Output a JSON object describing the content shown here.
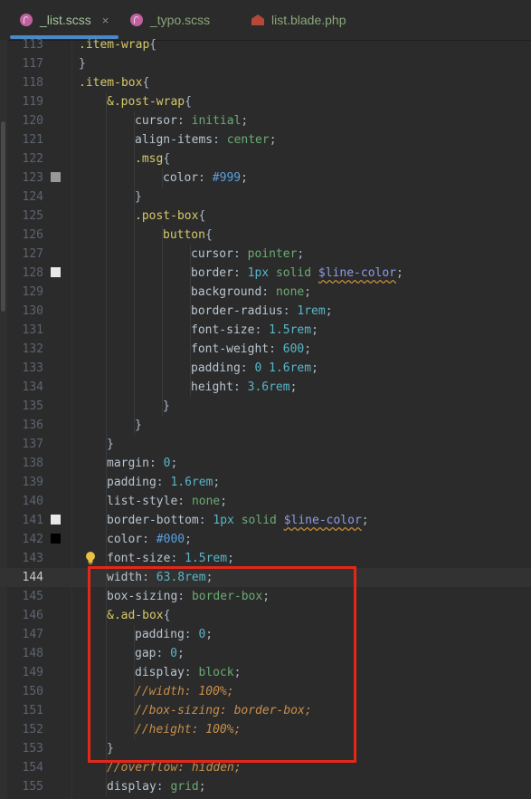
{
  "tabs": [
    {
      "label": "_list.scss",
      "icon": "sass-file-icon",
      "active": true,
      "close": "×"
    },
    {
      "label": "_typo.scss",
      "icon": "sass-file-icon",
      "active": false
    },
    {
      "label": "list.blade.php",
      "icon": "php-file-icon",
      "active": false
    }
  ],
  "colors": {
    "accent": "#4a88c7",
    "highlight_box": "#e3281a",
    "swatch_999": "#999999",
    "swatch_line_color": "#e8e8e8",
    "swatch_000": "#000000"
  },
  "editor": {
    "current_line": "144",
    "lines": [
      {
        "n": "113",
        "ind": 0,
        "tokens": [
          [
            ".item-wrap",
            "sel"
          ],
          [
            "{",
            "punc"
          ]
        ]
      },
      {
        "n": "117",
        "ind": 0,
        "tokens": [
          [
            "}",
            "punc"
          ]
        ]
      },
      {
        "n": "118",
        "ind": 0,
        "tokens": [
          [
            ".item-box",
            "sel"
          ],
          [
            "{",
            "punc"
          ]
        ]
      },
      {
        "n": "119",
        "ind": 1,
        "tokens": [
          [
            "&.post-wrap",
            "sel"
          ],
          [
            "{",
            "punc"
          ]
        ]
      },
      {
        "n": "120",
        "ind": 2,
        "tokens": [
          [
            "cursor",
            "prop"
          ],
          [
            ": ",
            "punc"
          ],
          [
            "initial",
            "kw"
          ],
          [
            ";",
            "punc"
          ]
        ]
      },
      {
        "n": "121",
        "ind": 2,
        "tokens": [
          [
            "align-items",
            "prop"
          ],
          [
            ": ",
            "punc"
          ],
          [
            "center",
            "kw"
          ],
          [
            ";",
            "punc"
          ]
        ]
      },
      {
        "n": "122",
        "ind": 2,
        "tokens": [
          [
            ".msg",
            "sel"
          ],
          [
            "{",
            "punc"
          ]
        ]
      },
      {
        "n": "123",
        "ind": 3,
        "swatch": "#999999",
        "tokens": [
          [
            "color",
            "prop"
          ],
          [
            ": ",
            "punc"
          ],
          [
            "#999",
            "hex"
          ],
          [
            ";",
            "punc"
          ]
        ]
      },
      {
        "n": "124",
        "ind": 2,
        "tokens": [
          [
            "}",
            "punc"
          ]
        ]
      },
      {
        "n": "125",
        "ind": 2,
        "tokens": [
          [
            ".post-box",
            "sel"
          ],
          [
            "{",
            "punc"
          ]
        ]
      },
      {
        "n": "126",
        "ind": 3,
        "tokens": [
          [
            "button",
            "sel"
          ],
          [
            "{",
            "punc"
          ]
        ]
      },
      {
        "n": "127",
        "ind": 4,
        "tokens": [
          [
            "cursor",
            "prop"
          ],
          [
            ": ",
            "punc"
          ],
          [
            "pointer",
            "kw"
          ],
          [
            ";",
            "punc"
          ]
        ]
      },
      {
        "n": "128",
        "ind": 4,
        "swatch": "#e8e8e8",
        "tokens": [
          [
            "border",
            "prop"
          ],
          [
            ": ",
            "punc"
          ],
          [
            "1px",
            "num"
          ],
          [
            " ",
            "punc"
          ],
          [
            "solid",
            "kw"
          ],
          [
            " ",
            "punc"
          ],
          [
            "$line-color",
            "var"
          ],
          [
            ";",
            "punc"
          ]
        ]
      },
      {
        "n": "129",
        "ind": 4,
        "tokens": [
          [
            "background",
            "prop"
          ],
          [
            ": ",
            "punc"
          ],
          [
            "none",
            "kw"
          ],
          [
            ";",
            "punc"
          ]
        ]
      },
      {
        "n": "130",
        "ind": 4,
        "tokens": [
          [
            "border-radius",
            "prop"
          ],
          [
            ": ",
            "punc"
          ],
          [
            "1rem",
            "num"
          ],
          [
            ";",
            "punc"
          ]
        ]
      },
      {
        "n": "131",
        "ind": 4,
        "tokens": [
          [
            "font-size",
            "prop"
          ],
          [
            ": ",
            "punc"
          ],
          [
            "1.5rem",
            "num"
          ],
          [
            ";",
            "punc"
          ]
        ]
      },
      {
        "n": "132",
        "ind": 4,
        "tokens": [
          [
            "font-weight",
            "prop"
          ],
          [
            ": ",
            "punc"
          ],
          [
            "600",
            "num"
          ],
          [
            ";",
            "punc"
          ]
        ]
      },
      {
        "n": "133",
        "ind": 4,
        "tokens": [
          [
            "padding",
            "prop"
          ],
          [
            ": ",
            "punc"
          ],
          [
            "0",
            "num"
          ],
          [
            " ",
            "punc"
          ],
          [
            "1.6rem",
            "num"
          ],
          [
            ";",
            "punc"
          ]
        ]
      },
      {
        "n": "134",
        "ind": 4,
        "tokens": [
          [
            "height",
            "prop"
          ],
          [
            ": ",
            "punc"
          ],
          [
            "3.6rem",
            "num"
          ],
          [
            ";",
            "punc"
          ]
        ]
      },
      {
        "n": "135",
        "ind": 3,
        "tokens": [
          [
            "}",
            "punc"
          ]
        ]
      },
      {
        "n": "136",
        "ind": 2,
        "tokens": [
          [
            "}",
            "punc"
          ]
        ]
      },
      {
        "n": "137",
        "ind": 1,
        "tokens": [
          [
            "}",
            "punc"
          ]
        ]
      },
      {
        "n": "138",
        "ind": 1,
        "tokens": [
          [
            "margin",
            "prop"
          ],
          [
            ": ",
            "punc"
          ],
          [
            "0",
            "num"
          ],
          [
            ";",
            "punc"
          ]
        ]
      },
      {
        "n": "139",
        "ind": 1,
        "tokens": [
          [
            "padding",
            "prop"
          ],
          [
            ": ",
            "punc"
          ],
          [
            "1.6rem",
            "num"
          ],
          [
            ";",
            "punc"
          ]
        ]
      },
      {
        "n": "140",
        "ind": 1,
        "tokens": [
          [
            "list-style",
            "prop"
          ],
          [
            ": ",
            "punc"
          ],
          [
            "none",
            "kw"
          ],
          [
            ";",
            "punc"
          ]
        ]
      },
      {
        "n": "141",
        "ind": 1,
        "swatch": "#e8e8e8",
        "tokens": [
          [
            "border-bottom",
            "prop"
          ],
          [
            ": ",
            "punc"
          ],
          [
            "1px",
            "num"
          ],
          [
            " ",
            "punc"
          ],
          [
            "solid",
            "kw"
          ],
          [
            " ",
            "punc"
          ],
          [
            "$line-color",
            "var"
          ],
          [
            ";",
            "punc"
          ]
        ]
      },
      {
        "n": "142",
        "ind": 1,
        "swatch": "#000000",
        "tokens": [
          [
            "color",
            "prop"
          ],
          [
            ": ",
            "punc"
          ],
          [
            "#000",
            "hex"
          ],
          [
            ";",
            "punc"
          ]
        ]
      },
      {
        "n": "143",
        "ind": 1,
        "bulb": true,
        "tokens": [
          [
            "font-size",
            "prop"
          ],
          [
            ": ",
            "punc"
          ],
          [
            "1.5rem",
            "num"
          ],
          [
            ";",
            "punc"
          ]
        ]
      },
      {
        "n": "144",
        "ind": 1,
        "tokens": [
          [
            "width",
            "prop"
          ],
          [
            ": ",
            "punc"
          ],
          [
            "63.8rem",
            "num"
          ],
          [
            ";",
            "punc"
          ]
        ]
      },
      {
        "n": "145",
        "ind": 1,
        "tokens": [
          [
            "box-sizing",
            "prop"
          ],
          [
            ": ",
            "punc"
          ],
          [
            "border-box",
            "kw"
          ],
          [
            ";",
            "punc"
          ]
        ]
      },
      {
        "n": "146",
        "ind": 1,
        "tokens": [
          [
            "&.ad-box",
            "sel"
          ],
          [
            "{",
            "punc"
          ]
        ]
      },
      {
        "n": "147",
        "ind": 2,
        "tokens": [
          [
            "padding",
            "prop"
          ],
          [
            ": ",
            "punc"
          ],
          [
            "0",
            "num"
          ],
          [
            ";",
            "punc"
          ]
        ]
      },
      {
        "n": "148",
        "ind": 2,
        "tokens": [
          [
            "gap",
            "prop"
          ],
          [
            ": ",
            "punc"
          ],
          [
            "0",
            "num"
          ],
          [
            ";",
            "punc"
          ]
        ]
      },
      {
        "n": "149",
        "ind": 2,
        "tokens": [
          [
            "display",
            "prop"
          ],
          [
            ": ",
            "punc"
          ],
          [
            "block",
            "kw"
          ],
          [
            ";",
            "punc"
          ]
        ]
      },
      {
        "n": "150",
        "ind": 2,
        "tokens": [
          [
            "//width: 100%;",
            "com"
          ]
        ]
      },
      {
        "n": "151",
        "ind": 2,
        "tokens": [
          [
            "//box-sizing: border-box;",
            "com"
          ]
        ]
      },
      {
        "n": "152",
        "ind": 2,
        "tokens": [
          [
            "//height: 100%;",
            "com"
          ]
        ]
      },
      {
        "n": "153",
        "ind": 1,
        "tokens": [
          [
            "}",
            "punc"
          ]
        ]
      },
      {
        "n": "154",
        "ind": 1,
        "tokens": [
          [
            "//overflow: hidden;",
            "com"
          ]
        ]
      },
      {
        "n": "155",
        "ind": 1,
        "tokens": [
          [
            "display",
            "prop"
          ],
          [
            ": ",
            "punc"
          ],
          [
            "grid",
            "kw"
          ],
          [
            ";",
            "punc"
          ]
        ]
      }
    ]
  }
}
